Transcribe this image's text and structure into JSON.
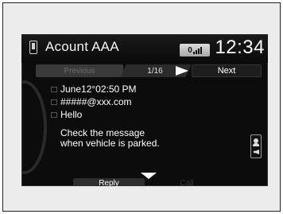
{
  "status_bar": {
    "account_name": "Acount AAA",
    "signal_label": "0",
    "time": "12:34"
  },
  "nav": {
    "previous_label": "Previous",
    "counter": "1/16",
    "next_label": "Next"
  },
  "message": {
    "date": "June12°02:50 PM",
    "sender": "#####@xxx.com",
    "subject": "Hello",
    "body": "Check the message\nwhen vehicle is parked."
  },
  "actions": {
    "reply_label": "Reply",
    "call_label": "Call"
  },
  "icons": {
    "phone": "phone-icon",
    "signal": "signal-strength-icon",
    "forward": "next-arrow-icon",
    "scroll": "scroll-down-icon",
    "voice": "voice-readout-icon"
  }
}
